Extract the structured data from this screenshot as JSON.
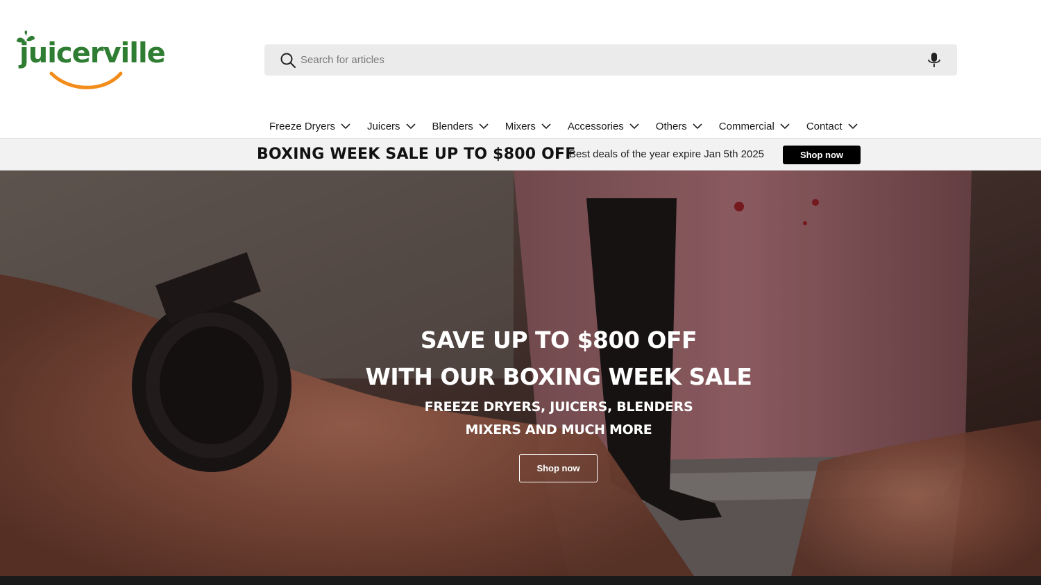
{
  "brand": {
    "name": "juicerville",
    "colors": {
      "green": "#2e7d32",
      "orange": "#f28c1a"
    }
  },
  "search": {
    "placeholder": "Search for articles",
    "value": "",
    "search_icon": "search-icon",
    "mic_icon": "microphone-icon"
  },
  "nav": {
    "items": [
      {
        "label": "Freeze Dryers",
        "icon": "chevron-down-icon"
      },
      {
        "label": "Juicers",
        "icon": "chevron-down-icon"
      },
      {
        "label": "Blenders",
        "icon": "chevron-down-icon"
      },
      {
        "label": "Mixers",
        "icon": "chevron-down-icon"
      },
      {
        "label": "Accessories",
        "icon": "chevron-down-icon"
      },
      {
        "label": "Others",
        "icon": "chevron-down-icon"
      },
      {
        "label": "Commercial",
        "icon": "chevron-down-icon"
      },
      {
        "label": "Contact",
        "icon": "chevron-down-icon"
      }
    ]
  },
  "promo": {
    "title": "BOXING WEEK SALE UP TO $800 OFF",
    "subtitle": "Best deals of the year expire Jan 5th 2025",
    "button_label": "Shop now"
  },
  "hero": {
    "heading_line1": "SAVE UP TO $800 OFF",
    "heading_line2": "WITH OUR BOXING WEEK SALE",
    "sub_line1": "FREEZE DRYERS, JUICERS, BLENDERS",
    "sub_line2": "MIXERS AND MUCH MORE",
    "button_label": "Shop now"
  }
}
